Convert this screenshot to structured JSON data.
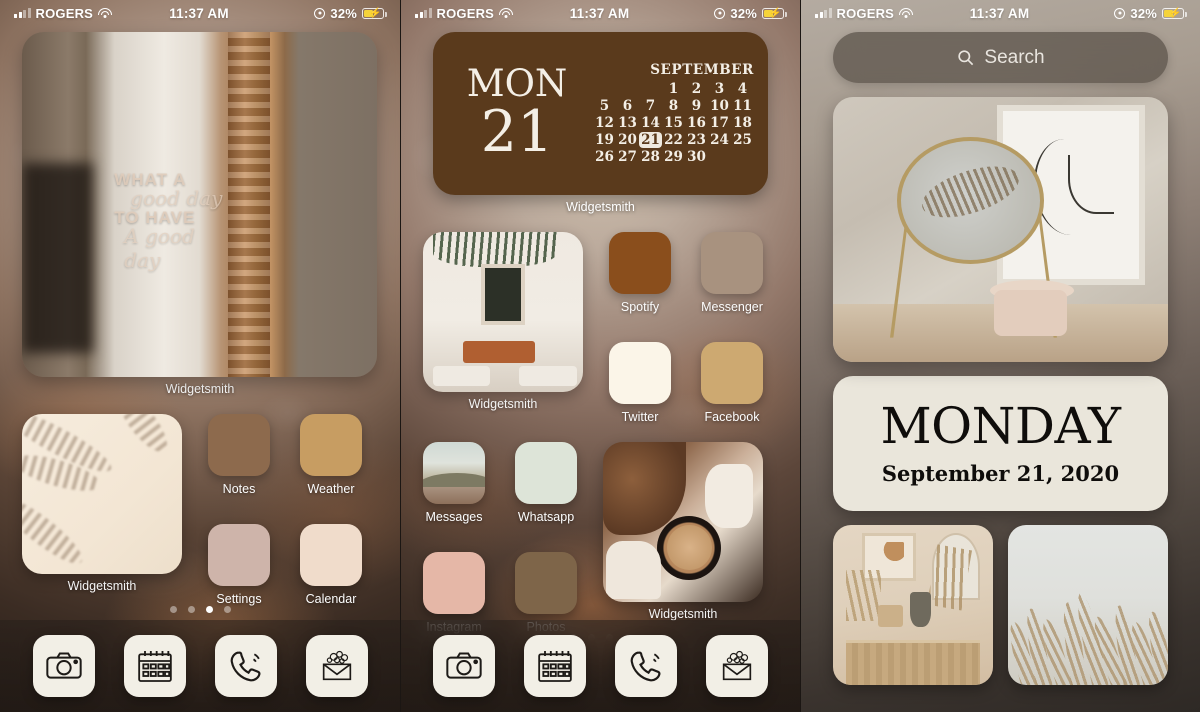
{
  "status_bar": {
    "carrier": "ROGERS",
    "time": "11:37 AM",
    "battery_percent": "32%",
    "signal_icon": "cellular-bars-icon",
    "wifi_icon": "wifi-icon",
    "location_icon": "location-services-icon",
    "battery_icon": "battery-charging-icon"
  },
  "screen1": {
    "photo_widget": {
      "label": "Widgetsmith",
      "overlay_line1": "WHAT A",
      "overlay_line2": "good day",
      "overlay_line3": "TO HAVE",
      "overlay_line4": "A good day"
    },
    "small_widget": {
      "label": "Widgetsmith"
    },
    "apps": [
      {
        "name": "Notes",
        "color": "#8d6a4d"
      },
      {
        "name": "Weather",
        "color": "#c79d62"
      },
      {
        "name": "Settings",
        "color": "#ceb4aa"
      },
      {
        "name": "Calendar",
        "color": "#f0dccb"
      }
    ],
    "page_dots": {
      "count": 4,
      "active": 3
    }
  },
  "screen2": {
    "calendar_widget": {
      "day_of_week": "MON",
      "day_number": "21",
      "month": "SEPTEMBER",
      "label": "Widgetsmith",
      "leading_blanks": 3,
      "days": [
        1,
        2,
        3,
        4,
        5,
        6,
        7,
        8,
        9,
        10,
        11,
        12,
        13,
        14,
        15,
        16,
        17,
        18,
        19,
        20,
        21,
        22,
        23,
        24,
        25,
        26,
        27,
        28,
        29,
        30
      ],
      "today": 21,
      "background_color": "#5a3a1c"
    },
    "cafe_widget": {
      "label": "Widgetsmith"
    },
    "coffee_widget": {
      "label": "Widgetsmith"
    },
    "apps_row1": [
      {
        "name": "Spotify",
        "color": "#8a4e1c"
      },
      {
        "name": "Messenger",
        "color": "#a8927f"
      }
    ],
    "apps_row2": [
      {
        "name": "Twitter",
        "color": "#fbf5e8"
      },
      {
        "name": "Facebook",
        "color": "#cda971"
      }
    ],
    "apps_row3": [
      {
        "name": "Messages",
        "color": "#b9bdb2"
      },
      {
        "name": "Whatsapp",
        "color": "#dde4d8"
      }
    ],
    "apps_row4": [
      {
        "name": "Instagram",
        "color": "#e5b7a7"
      },
      {
        "name": "Photos",
        "color": "#7e6549"
      }
    ],
    "page_dots": {
      "count": 4,
      "active": 1
    }
  },
  "screen3": {
    "search": {
      "placeholder": "Search",
      "icon": "search-icon"
    },
    "date_widget": {
      "day": "MONDAY",
      "date": "September 21, 2020",
      "background_color": "#eae6db"
    }
  },
  "dock": {
    "apps": [
      {
        "name": "Camera",
        "icon": "camera-icon"
      },
      {
        "name": "Calendar",
        "icon": "calendar-icon"
      },
      {
        "name": "Phone",
        "icon": "phone-ringing-icon"
      },
      {
        "name": "Mail",
        "icon": "envelope-flowers-icon"
      }
    ]
  }
}
